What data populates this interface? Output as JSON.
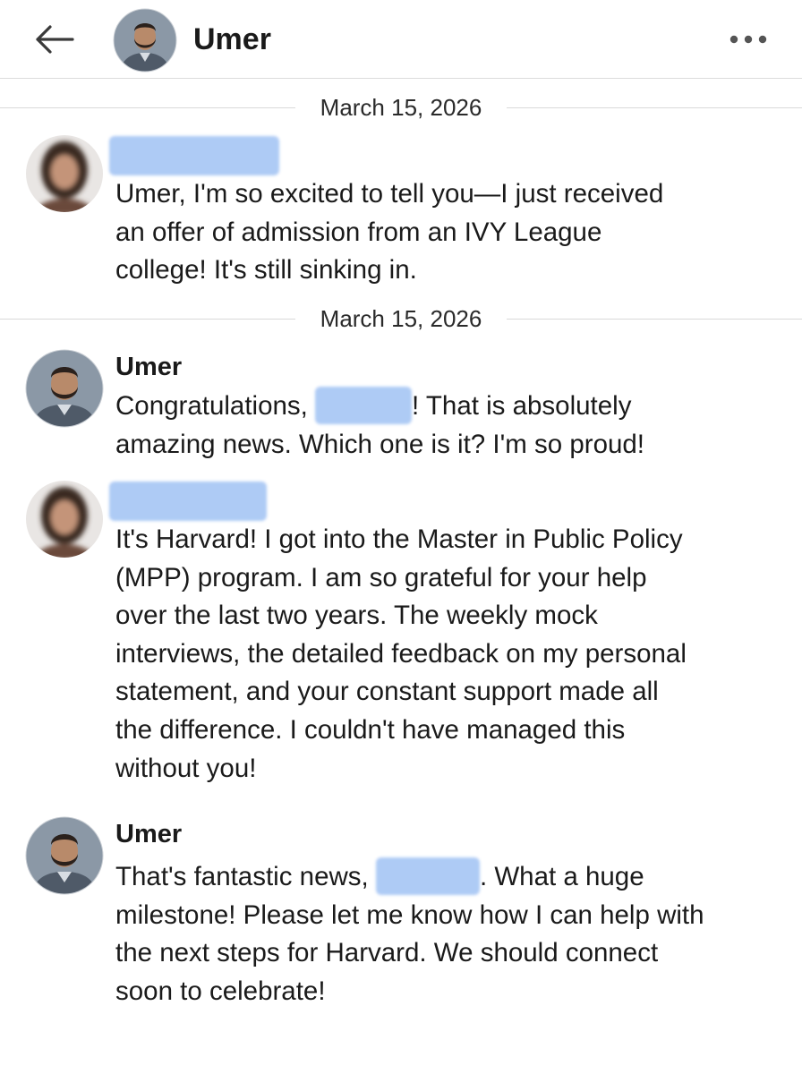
{
  "header": {
    "title": "Umer",
    "back_icon": "back-arrow-icon",
    "more_icon": "more-options-icon"
  },
  "conversation": {
    "date_separators": [
      "March 15, 2026",
      "March 15, 2026"
    ],
    "messages": [
      {
        "sender": "",
        "sender_redacted": true,
        "lines": [
          "Umer, I'm so excited to tell you—I just received",
          "an offer of admission from an IVY League",
          "college! It's still sinking in."
        ]
      },
      {
        "sender": "Umer",
        "greeting_prefix": "Congratulations, ",
        "greeting_suffix": "! That is absolutely",
        "lines": [
          "amazing news. Which one is it? I'm so proud!"
        ]
      },
      {
        "sender": "",
        "sender_redacted": true,
        "lines": [
          "It's Harvard! I got into the Master in Public Policy",
          "(MPP) program. I am so grateful for your help",
          "over the last two years. The weekly mock",
          "interviews, the detailed feedback on my personal",
          "statement, and your constant support made all",
          "the difference. I couldn't have managed this",
          "without you!"
        ]
      },
      {
        "sender": "Umer",
        "first_prefix": "That's fantastic news, ",
        "first_suffix": ". What a huge",
        "lines": [
          "milestone! Please let me know how I can help with",
          "the next steps for Harvard. We should connect",
          "soon to celebrate!"
        ]
      }
    ]
  },
  "colors": {
    "redaction": "#aecbf5",
    "divider": "#d9d9d9",
    "text": "#1a1a1a"
  }
}
